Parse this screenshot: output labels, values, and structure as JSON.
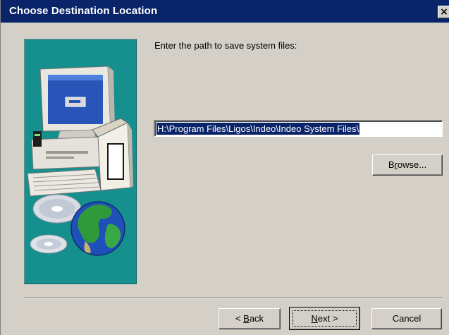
{
  "window": {
    "title": "Choose Destination Location",
    "close_glyph": "×"
  },
  "main": {
    "prompt": "Enter the path to save system files:",
    "path_value": "H:\\Program Files\\Ligos\\Indeo\\Indeo System Files\\"
  },
  "buttons": {
    "browse": {
      "pre": "B",
      "u": "r",
      "post": "owse..."
    },
    "back": {
      "pre": "< ",
      "u": "B",
      "post": "ack"
    },
    "next": {
      "pre": "",
      "u": "N",
      "post": "ext >"
    },
    "cancel": "Cancel"
  },
  "illustration": {
    "icons": [
      "computer-icon",
      "cd-rom-icon",
      "globe-icon",
      "box-icon"
    ]
  },
  "colors": {
    "titlebar": "#0a246a",
    "dialog_face": "#d4d0c8",
    "art_panel": "#168f8f",
    "selection": "#0a246a"
  }
}
